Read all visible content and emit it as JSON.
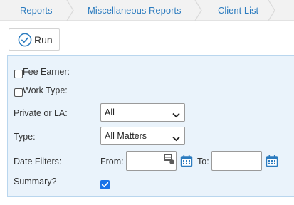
{
  "breadcrumb": {
    "items": [
      {
        "label": "Reports"
      },
      {
        "label": "Miscellaneous Reports"
      },
      {
        "label": "Client List"
      }
    ]
  },
  "toolbar": {
    "run_label": "Run"
  },
  "form": {
    "fee_earner_label": "Fee Earner:",
    "work_type_label": "Work Type:",
    "private_or_la": {
      "label": "Private or LA:",
      "value": "All"
    },
    "type": {
      "label": "Type:",
      "value": "All Matters"
    },
    "date_filters": {
      "label": "Date Filters:",
      "from_label": "From:",
      "to_label": "To:",
      "from_value": "",
      "to_value": ""
    },
    "summary": {
      "label": "Summary?",
      "checked": true
    }
  },
  "colors": {
    "link": "#2b7bbf",
    "panel_bg": "#eaf3fb",
    "accent": "#1a73e8"
  }
}
